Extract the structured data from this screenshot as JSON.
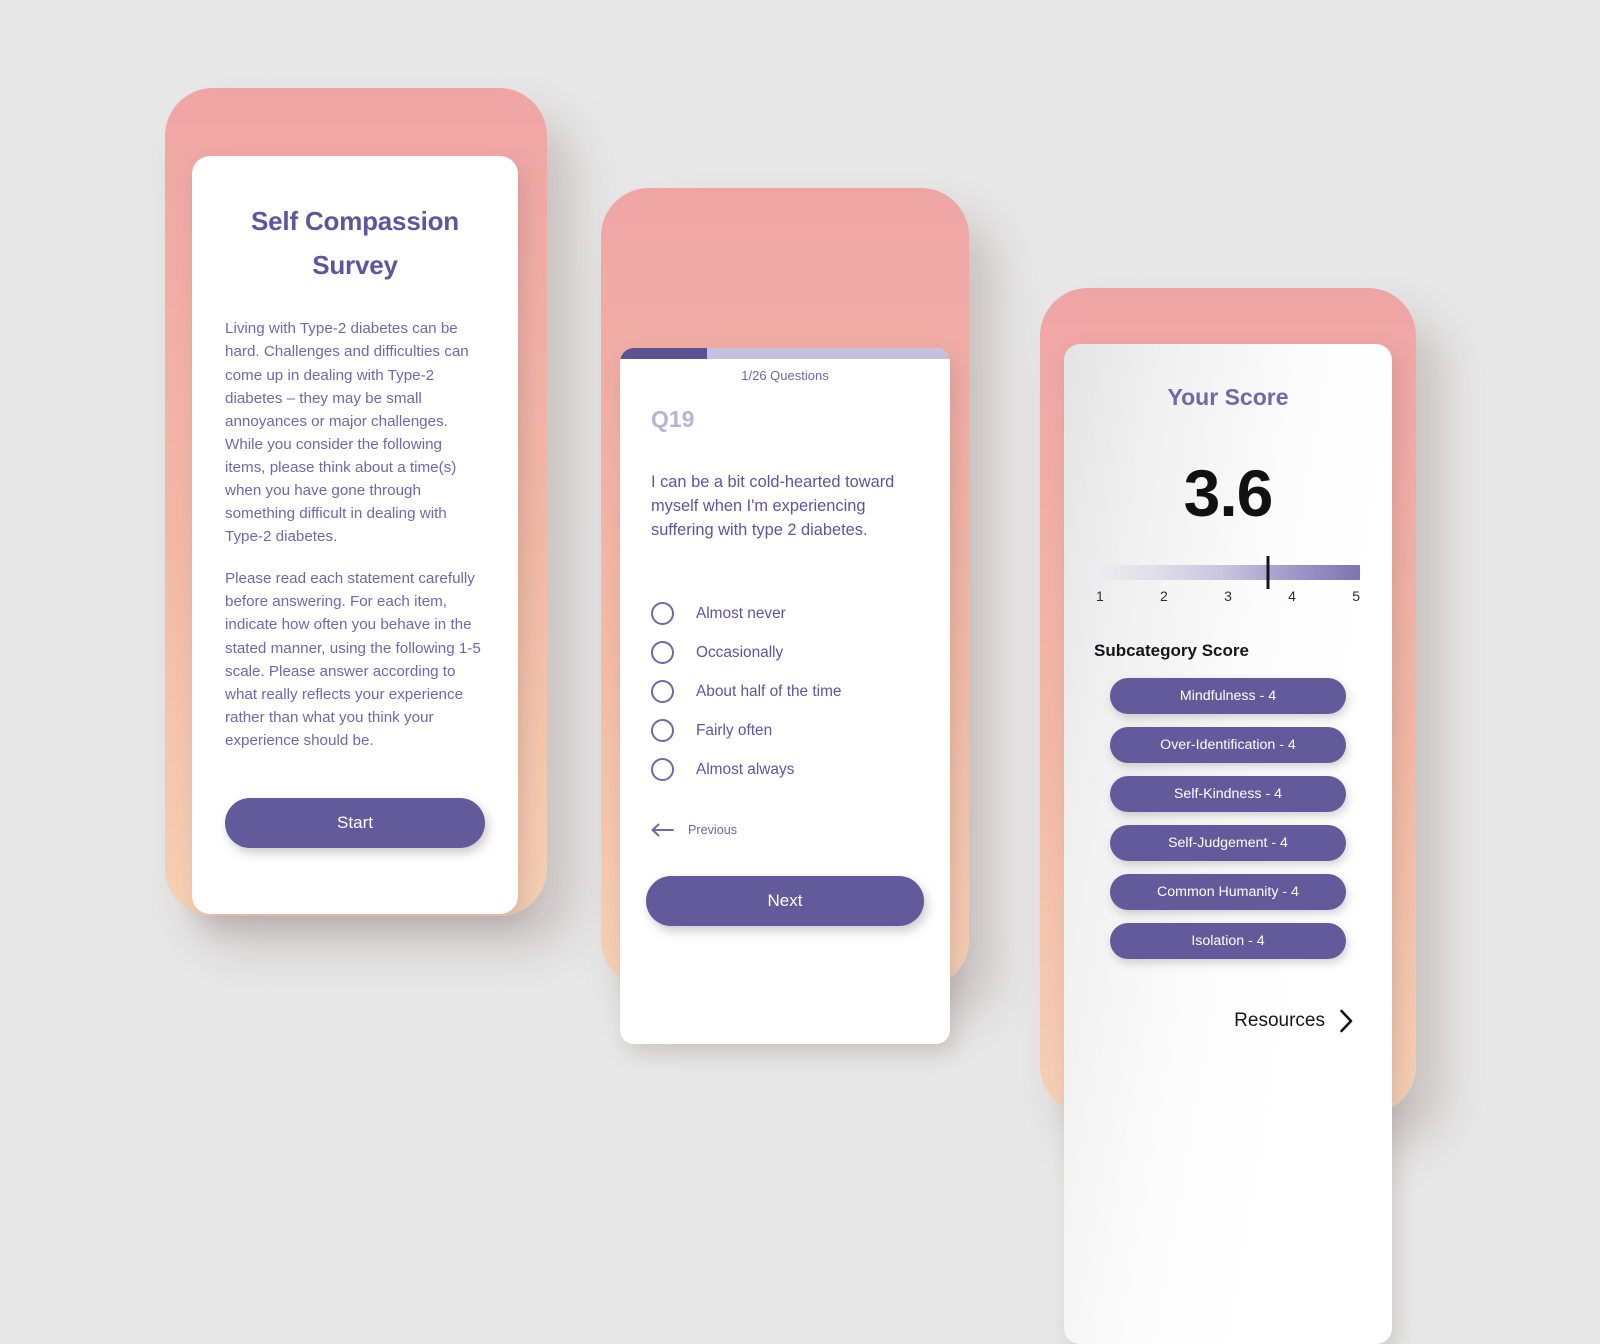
{
  "theme": {
    "purple": "#635a9c",
    "purple_text": "#5e54a0",
    "purple_muted": "#6f68ab",
    "lavender": "#c5c0de",
    "frame_top": "#f0a5a5",
    "frame_bottom": "#f6d0b4",
    "background": "#e8e8e8"
  },
  "screen_intro": {
    "title": "Self Compassion Survey",
    "paragraph_1": "Living with Type-2 diabetes can be hard. Challenges and difficulties can come up in dealing with Type-2 diabetes – they may be small annoyances or major challenges. While you consider the following items, please think about a time(s) when you have gone through something difficult in dealing with Type-2 diabetes.",
    "paragraph_2": "Please read each statement carefully before answering. For each item, indicate how often you behave in the stated manner, using the following 1-5 scale. Please answer according to what really reflects your experience rather than what you think your experience should be.",
    "start_label": "Start"
  },
  "screen_question": {
    "progress_label": "1/26 Questions",
    "progress_percent": 26.5,
    "question_number": "Q19",
    "question_text": "I can be a bit cold-hearted toward myself when I'm experiencing suffering with type 2 diabetes.",
    "options": [
      {
        "label": "Almost never"
      },
      {
        "label": "Occasionally"
      },
      {
        "label": "About half of the time"
      },
      {
        "label": "Fairly often"
      },
      {
        "label": "Almost always"
      }
    ],
    "previous_label": "Previous",
    "next_label": "Next"
  },
  "screen_score": {
    "title": "Your Score",
    "score": "3.6",
    "scale_ticks": [
      "1",
      "2",
      "3",
      "4",
      "5"
    ],
    "marker_percent": 65,
    "subcategory_title": "Subcategory Score",
    "subcategories": [
      {
        "label": "Mindfulness - 4"
      },
      {
        "label": "Over-Identification - 4"
      },
      {
        "label": "Self-Kindness - 4"
      },
      {
        "label": "Self-Judgement - 4"
      },
      {
        "label": "Common Humanity - 4"
      },
      {
        "label": "Isolation - 4"
      }
    ],
    "resources_label": "Resources"
  }
}
